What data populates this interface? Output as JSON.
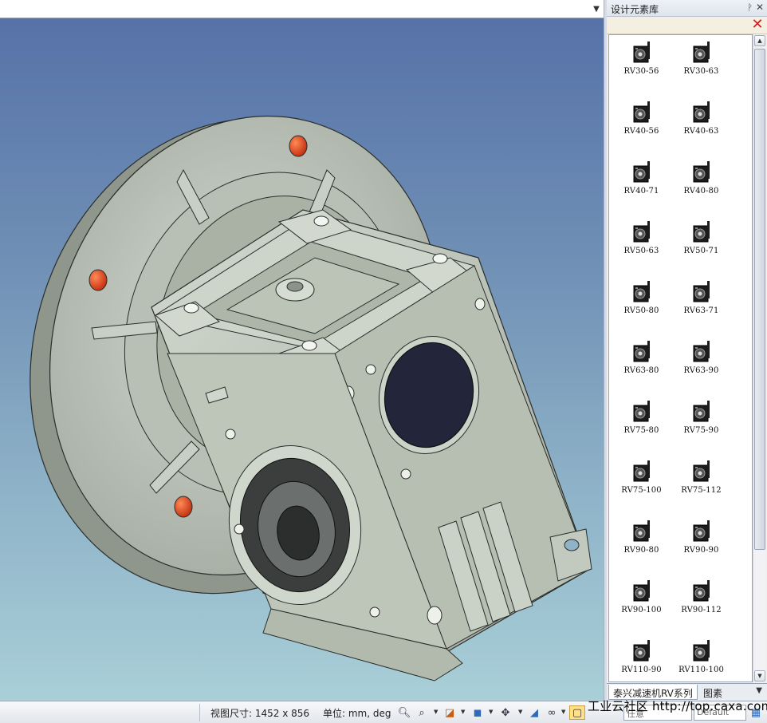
{
  "panel": {
    "title": "设计元素库",
    "pin_icon": "pin-icon",
    "close_icon": "close-icon",
    "delete_icon": "delete-icon",
    "items": [
      {
        "label": "RV30-56"
      },
      {
        "label": "RV30-63"
      },
      {
        "label": "RV40-56"
      },
      {
        "label": "RV40-63"
      },
      {
        "label": "RV40-71"
      },
      {
        "label": "RV40-80"
      },
      {
        "label": "RV50-63"
      },
      {
        "label": "RV50-71"
      },
      {
        "label": "RV50-80"
      },
      {
        "label": "RV63-71"
      },
      {
        "label": "RV63-80"
      },
      {
        "label": "RV63-90"
      },
      {
        "label": "RV75-80"
      },
      {
        "label": "RV75-90"
      },
      {
        "label": "RV75-100"
      },
      {
        "label": "RV75-112"
      },
      {
        "label": "RV90-80"
      },
      {
        "label": "RV90-90"
      },
      {
        "label": "RV90-100"
      },
      {
        "label": "RV90-112"
      },
      {
        "label": "RV110-90"
      },
      {
        "label": "RV110-100"
      }
    ],
    "tabs": [
      {
        "label": "泰兴减速机RV系列",
        "active": true
      },
      {
        "label": "图素",
        "active": false
      }
    ]
  },
  "status": {
    "view_size": "视图尺寸: 1452 x  856",
    "units": "单位: mm, deg",
    "field1": "任意",
    "field2": "Default"
  },
  "watermark": "工业云社区  http://top.caxa.com/",
  "colors": {
    "viewport_top": "#5672a8",
    "viewport_bottom": "#a9cfd8",
    "part_body": "#c3cbbf",
    "part_edge": "#2a2e2a",
    "bolt_holes": "#e0461f",
    "bore_dark": "#23263a",
    "delete_red": "#d01b1b"
  }
}
